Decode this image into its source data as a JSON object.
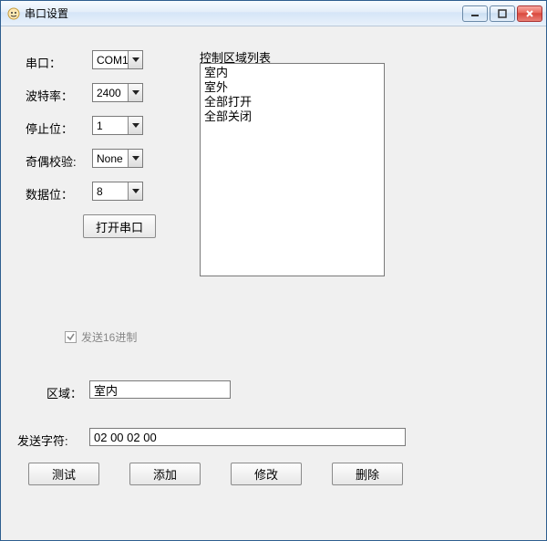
{
  "window": {
    "title": "串口设置"
  },
  "labels": {
    "port": "串口：",
    "baud": "波特率：",
    "stop": "停止位：",
    "parity": "奇偶校验:",
    "data": "数据位：",
    "open_port_btn": "打开串口",
    "zone_list_title": "控制区域列表",
    "send_hex": "发送16进制",
    "zone": "区域：",
    "send_chars": "发送字符:",
    "test_btn": "测试",
    "add_btn": "添加",
    "modify_btn": "修改",
    "delete_btn": "删除"
  },
  "values": {
    "port": "COM1",
    "baud": "2400",
    "stop": "1",
    "parity": "None",
    "data": "8",
    "zone": "室内",
    "send_chars": "02 00 02 00"
  },
  "zone_list": {
    "items": [
      "室内",
      "室外",
      "全部打开",
      "全部关闭"
    ]
  },
  "send_hex_checked": true
}
